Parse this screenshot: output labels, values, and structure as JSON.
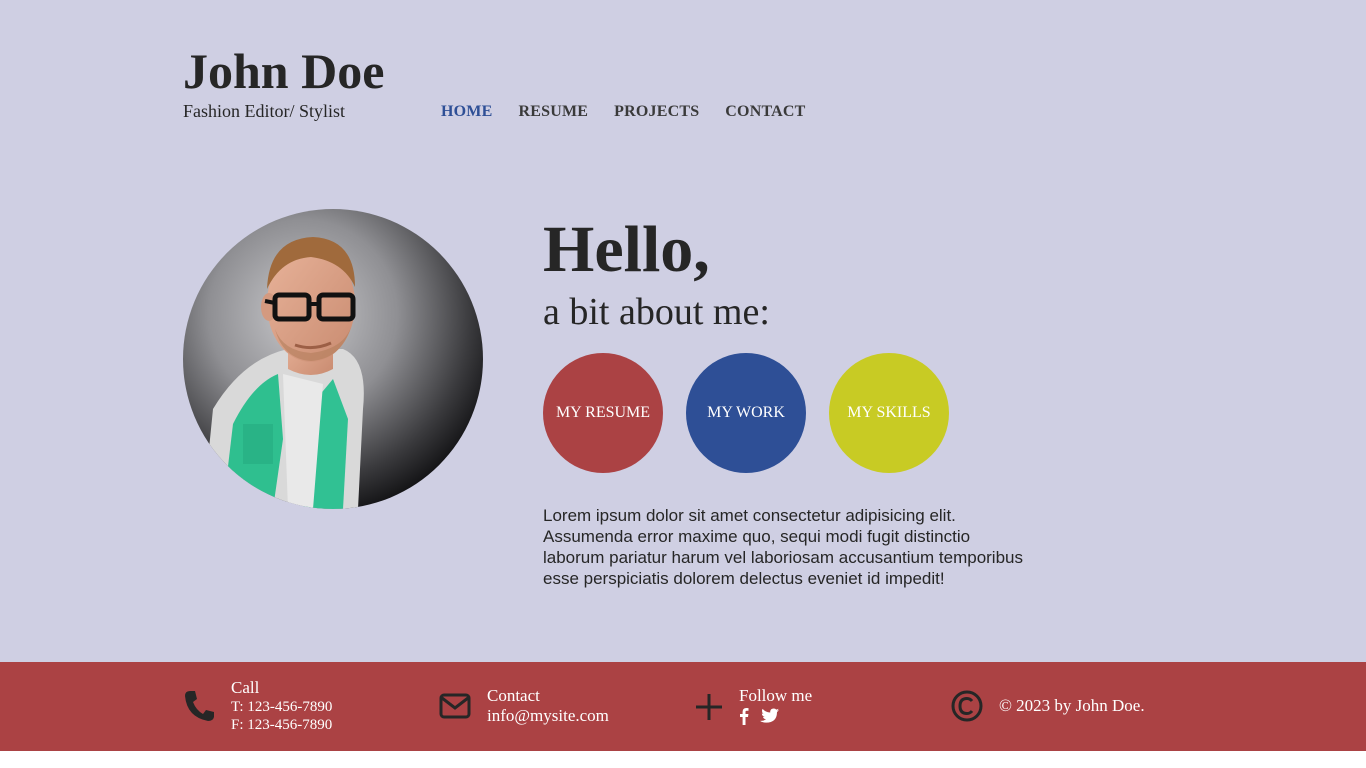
{
  "header": {
    "name": "John Doe",
    "tagline": "Fashion Editor/ Stylist",
    "nav": [
      {
        "label": "HOME",
        "active": true
      },
      {
        "label": "RESUME",
        "active": false
      },
      {
        "label": "PROJECTS",
        "active": false
      },
      {
        "label": "CONTACT",
        "active": false
      }
    ]
  },
  "intro": {
    "hello": "Hello,",
    "about": "a bit about me:",
    "buttons": [
      {
        "label": "MY RESUME",
        "color": "#ab4244"
      },
      {
        "label": "MY WORK",
        "color": "#2e4f96"
      },
      {
        "label": "MY SKILLS",
        "color": "#c8cb24"
      }
    ],
    "body_lines": [
      "Lorem ipsum dolor sit amet consectetur adipisicing elit.",
      "Assumenda error maxime quo, sequi modi fugit distinctio",
      "laborum pariatur harum vel laboriosam accusantium temporibus",
      "esse perspiciatis dolorem delectus eveniet id impedit!"
    ],
    "photo_icon": "profile-photo"
  },
  "footer": {
    "call": {
      "title": "Call",
      "tel": "T: 123-456-7890",
      "fax": "F: 123-456-7890",
      "icon": "phone-icon"
    },
    "contact": {
      "title": "Contact",
      "email": "info@mysite.com",
      "icon": "envelope-icon"
    },
    "follow": {
      "title": "Follow me",
      "icon": "plus-icon",
      "social": [
        "facebook-icon",
        "twitter-icon"
      ]
    },
    "copyright": {
      "text": "© 2023 by John Doe.",
      "icon": "copyright-icon"
    }
  },
  "colors": {
    "background": "#cfcfe3",
    "footer": "#ab4244",
    "accent_red": "#ab4244",
    "accent_blue": "#2e4f96",
    "accent_yellow": "#c8cb24",
    "text_dark": "#262626"
  }
}
